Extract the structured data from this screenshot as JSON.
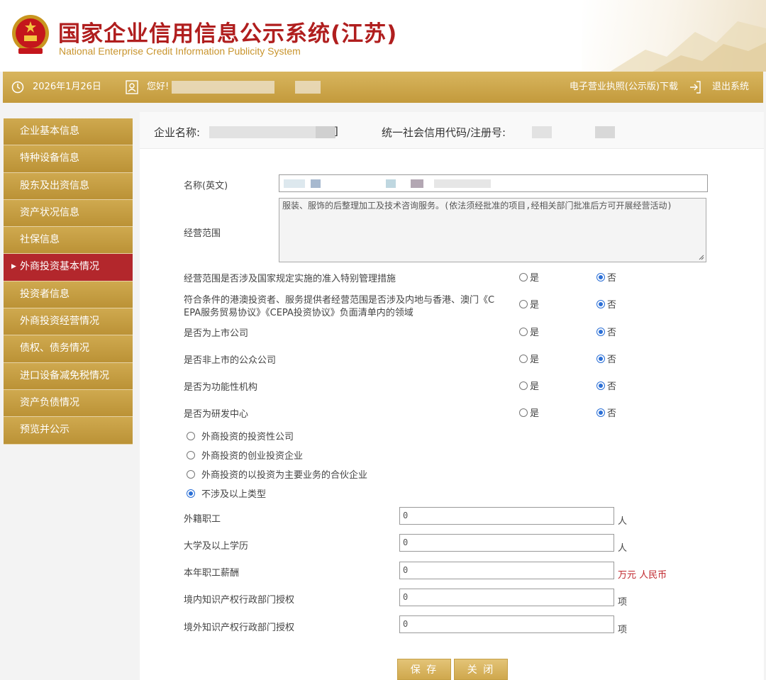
{
  "header": {
    "title_cn": "国家企业信用信息公示系统",
    "title_province": "(江苏)",
    "title_en": "National Enterprise Credit Information Publicity System"
  },
  "topbar": {
    "date": "2026年1月26日",
    "greeting": "您好!",
    "license_download": "电子营业执照(公示版)下载",
    "logout": "退出系统"
  },
  "sidebar": {
    "items": [
      {
        "label": "企业基本信息"
      },
      {
        "label": "特种设备信息"
      },
      {
        "label": "股东及出资信息"
      },
      {
        "label": "资产状况信息"
      },
      {
        "label": "社保信息"
      },
      {
        "label": "外商投资基本情况"
      },
      {
        "label": "投资者信息"
      },
      {
        "label": "外商投资经营情况"
      },
      {
        "label": "债权、债务情况"
      },
      {
        "label": "进口设备减免税情况"
      },
      {
        "label": "资产负债情况"
      },
      {
        "label": "预览并公示"
      }
    ],
    "active_index": 5
  },
  "company": {
    "name_label": "企业名称:",
    "name_tail": "]",
    "code_label": "统一社会信用代码/注册号:"
  },
  "form": {
    "english_name_label": "名称(英文)",
    "scope_label": "经营范围",
    "scope_value": "服装、服饰的后整理加工及技术咨询服务。(依法须经批准的项目,经相关部门批准后方可开展经营活动)",
    "yes": "是",
    "no": "否",
    "questions": [
      {
        "text": "经营范围是否涉及国家规定实施的准入特别管理措施",
        "selected": "否"
      },
      {
        "text": "符合条件的港澳投资者、服务提供者经营范围是否涉及内地与香港、澳门《CEPA服务贸易协议》《CEPA投资协议》负面清单内的领域",
        "selected": "否"
      },
      {
        "text": "是否为上市公司",
        "selected": "否"
      },
      {
        "text": "是否非上市的公众公司",
        "selected": "否"
      },
      {
        "text": "是否为功能性机构",
        "selected": "否"
      },
      {
        "text": "是否为研发中心",
        "selected": "否"
      }
    ],
    "q2_line1": "符合条件的港澳投资者、服务提供者经营范围是否涉及内地与香港、澳门《C",
    "q2_line2": "EPA服务贸易协议》《CEPA投资协议》负面清单内的领域",
    "investment_types": [
      {
        "label": "外商投资的投资性公司",
        "checked": false
      },
      {
        "label": "外商投资的创业投资企业",
        "checked": false
      },
      {
        "label": "外商投资的以投资为主要业务的合伙企业",
        "checked": false
      },
      {
        "label": "不涉及以上类型",
        "checked": true
      }
    ],
    "numbers": [
      {
        "label": "外籍职工",
        "value": "0",
        "unit": "人"
      },
      {
        "label": "大学及以上学历",
        "value": "0",
        "unit": "人"
      },
      {
        "label": "本年职工薪酬",
        "value": "0",
        "unit": "万元 人民币"
      },
      {
        "label": "境内知识产权行政部门授权",
        "value": "0",
        "unit": "项"
      },
      {
        "label": "境外知识产权行政部门授权",
        "value": "0",
        "unit": "项"
      }
    ]
  },
  "buttons": {
    "save": "保 存",
    "close": "关 闭"
  },
  "colors": {
    "gold": "#c9a144",
    "active_red": "#b3272c",
    "title_red": "#b01e1e",
    "radio_blue": "#2b6fd6"
  }
}
